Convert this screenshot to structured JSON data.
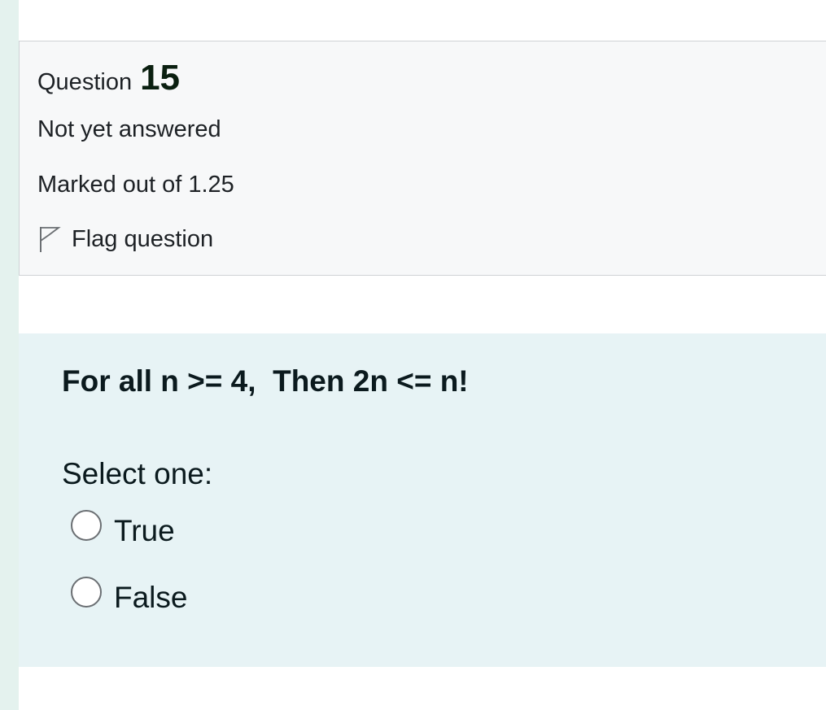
{
  "question": {
    "label": "Question",
    "number": "15",
    "state": "Not yet answered",
    "grade": "Marked out of 1.25",
    "flag_label": "Flag question",
    "flag_icon": "flag-outline-icon"
  },
  "content": {
    "text": "For all n >= 4,  Then 2n <= n!",
    "prompt": "Select one:",
    "options": [
      {
        "label": "True",
        "selected": false
      },
      {
        "label": "False",
        "selected": false
      }
    ]
  },
  "colors": {
    "left_strip": "#e4f2ee",
    "info_background": "#f7f8f9",
    "content_background": "#e7f3f5"
  }
}
